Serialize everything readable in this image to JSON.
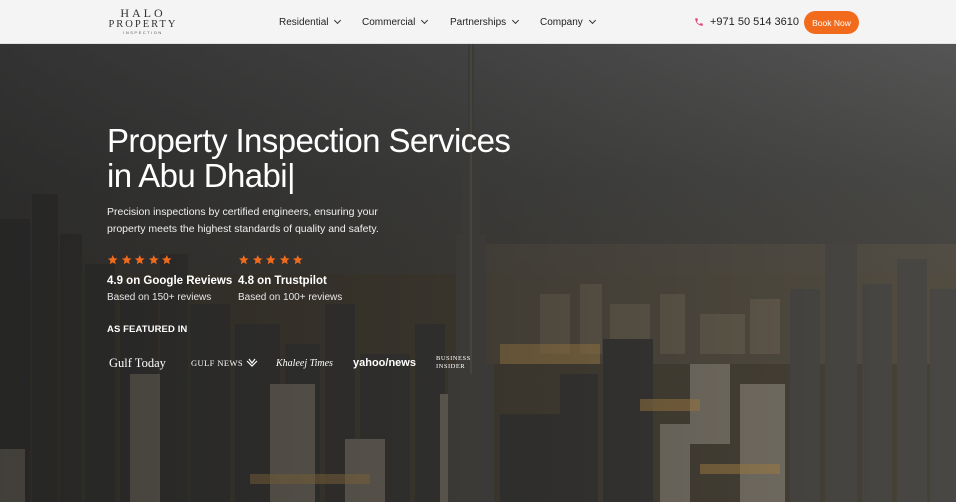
{
  "brand": {
    "line1": "HALO",
    "line2": "PROPERTY",
    "line3": "INSPECTION"
  },
  "nav": {
    "items": [
      {
        "label": "Residential"
      },
      {
        "label": "Commercial"
      },
      {
        "label": "Partnerships"
      },
      {
        "label": "Company"
      }
    ]
  },
  "header": {
    "phone": "+971 50 514 3610",
    "book_label": "Book Now"
  },
  "hero": {
    "title": "Property Inspection Services in Abu Dhabi|",
    "subtitle": "Precision inspections by certified engineers, ensuring your property meets the highest standards of quality and safety.",
    "ratings": [
      {
        "stars": 5,
        "headline": "4.9 on Google Reviews",
        "sub": "Based on 150+ reviews"
      },
      {
        "stars": 5,
        "headline": "4.8 on Trustpilot",
        "sub": "Based on 100+ reviews"
      }
    ],
    "featured_label": "AS FEATURED IN",
    "press": {
      "gulf_today": "Gulf Today",
      "gulf_news": "GULF NEWS",
      "khaleej_times": "Khaleej Times",
      "yahoo_news": "yahoo/news",
      "business_insider_1": "BUSINESS",
      "business_insider_2": "INSIDER"
    }
  },
  "colors": {
    "accent": "#f26b1d",
    "star": "#f26b1d",
    "phone_icon": "#e0457b",
    "header_bg": "#f4f4f4"
  },
  "icons": {
    "phone": "phone-icon",
    "chevron": "chevron-down-icon",
    "star": "star-icon"
  }
}
